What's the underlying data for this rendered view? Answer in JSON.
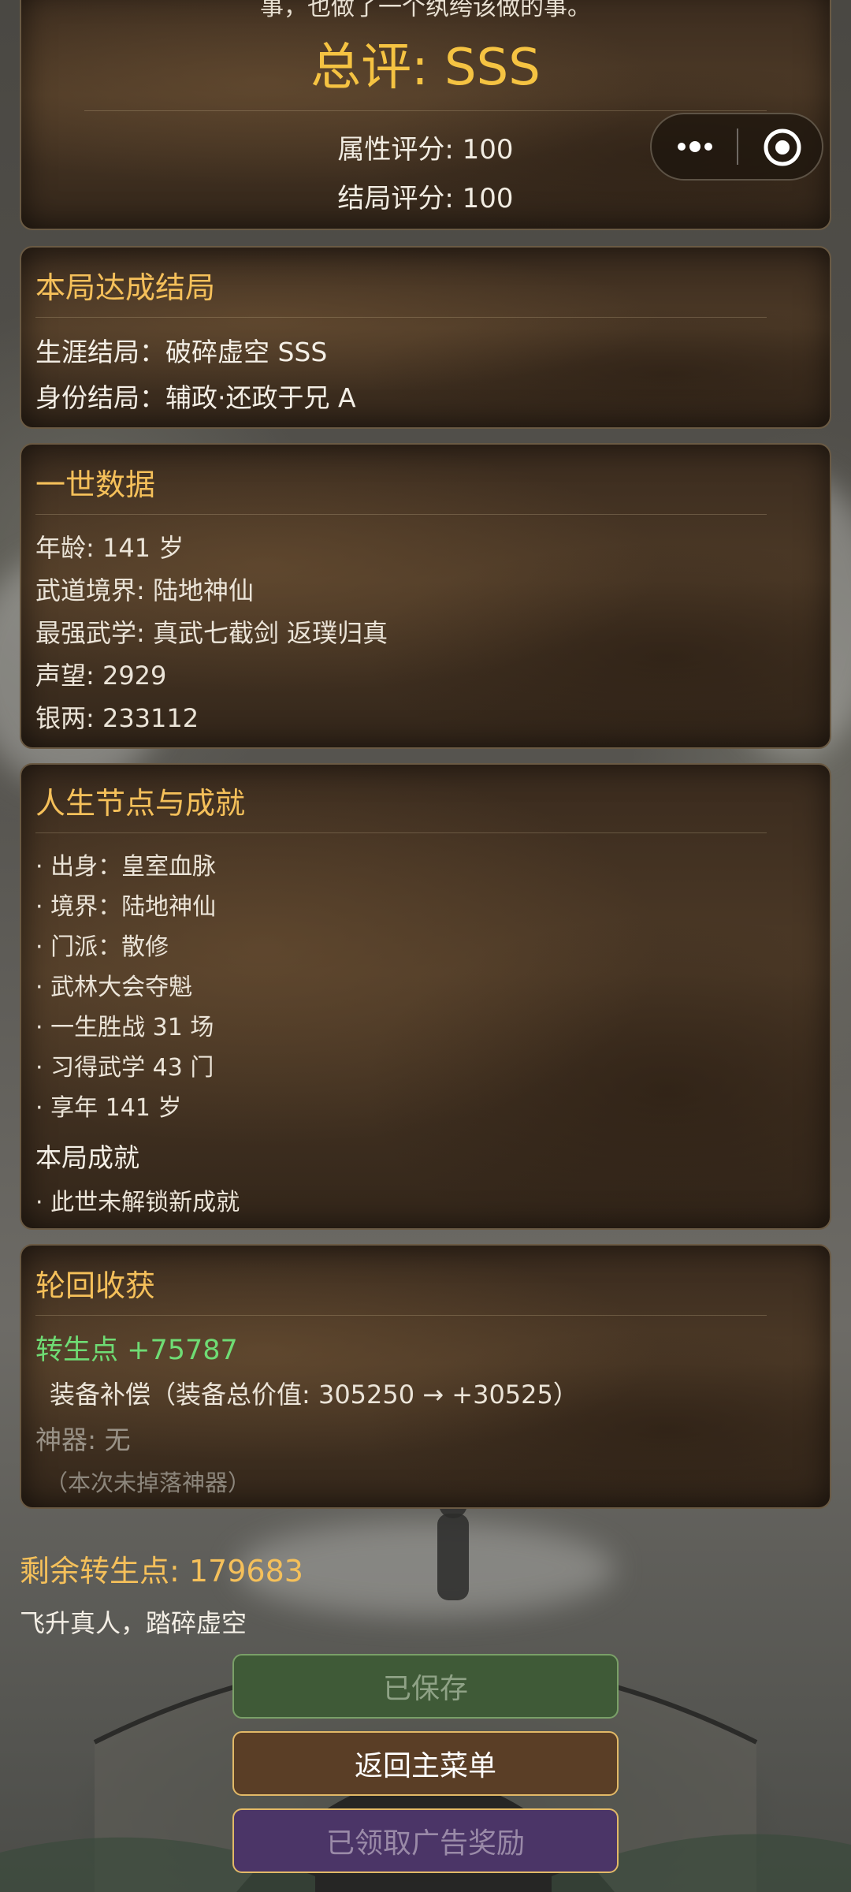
{
  "summary": {
    "top_text": "事，也做了一个纨绔该做的事。",
    "overall_label": "总评: SSS",
    "attr_score": "属性评分: 100",
    "ending_score": "结局评分: 100"
  },
  "endings": {
    "title": "本局达成结局",
    "career": "生涯结局：破碎虚空  SSS",
    "identity": "身份结局：辅政·还政于兄  A"
  },
  "life_data": {
    "title": "一世数据",
    "age": "年龄: 141 岁",
    "realm": "武道境界: 陆地神仙",
    "best_skill": "最强武学: 真武七截剑  返璞归真",
    "fame": "声望: 2929",
    "silver": "银两: 233112"
  },
  "milestones": {
    "title": "人生节点与成就",
    "items": [
      "· 出身：皇室血脉",
      "· 境界：陆地神仙",
      "· 门派：散修",
      "· 武林大会夺魁",
      "· 一生胜战 31 场",
      "· 习得武学 43 门",
      "· 享年 141 岁"
    ],
    "achievement_title": "本局成就",
    "achievement_item": "· 此世未解锁新成就"
  },
  "rewards": {
    "title": "轮回收获",
    "rebirth_points": "转生点 +75787",
    "equip_comp": "装备补偿（装备总价值: 305250 → +30525）",
    "artifact": "神器: 无",
    "artifact_note": "（本次未掉落神器）"
  },
  "remaining": {
    "points": "剩余转生点: 179683",
    "motto": "飞升真人，踏碎虚空"
  },
  "buttons": {
    "saved": "已保存",
    "main_menu": "返回主菜单",
    "ad_reward": "已领取广告奖励"
  },
  "colors": {
    "gold": "#f5c05a",
    "green": "#6fdc74",
    "saved_bg": "#3f5a37",
    "menu_bg": "#5a3e26",
    "ad_bg": "#4b3567"
  },
  "icons": {
    "more": "more-dots-icon",
    "close": "target-circle-icon"
  }
}
